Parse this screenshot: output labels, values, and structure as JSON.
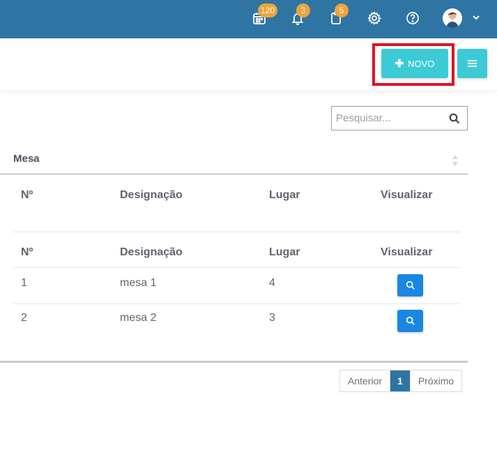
{
  "topbar": {
    "calendar_badge": "120",
    "notifications_badge": "3",
    "documents_badge": "5",
    "colors": {
      "bar": "#2e75a3",
      "badge": "#f0a33a"
    }
  },
  "actions": {
    "new_label": "NOVO",
    "new_icon": "plus-icon",
    "menu_icon": "hamburger-icon",
    "accent": "#3ccbd6"
  },
  "search": {
    "placeholder": "Pesquisar..."
  },
  "table": {
    "section_label": "Mesa",
    "headers": [
      "Nº",
      "Designação",
      "Lugar",
      "Visualizar"
    ],
    "rows": [
      {
        "num": "1",
        "designacao": "mesa 1",
        "lugar": "4"
      },
      {
        "num": "2",
        "designacao": "mesa 2",
        "lugar": "3"
      }
    ],
    "view_button_color": "#1a87e2"
  },
  "pagination": {
    "prev": "Anterior",
    "current": "1",
    "next": "Próximo"
  }
}
